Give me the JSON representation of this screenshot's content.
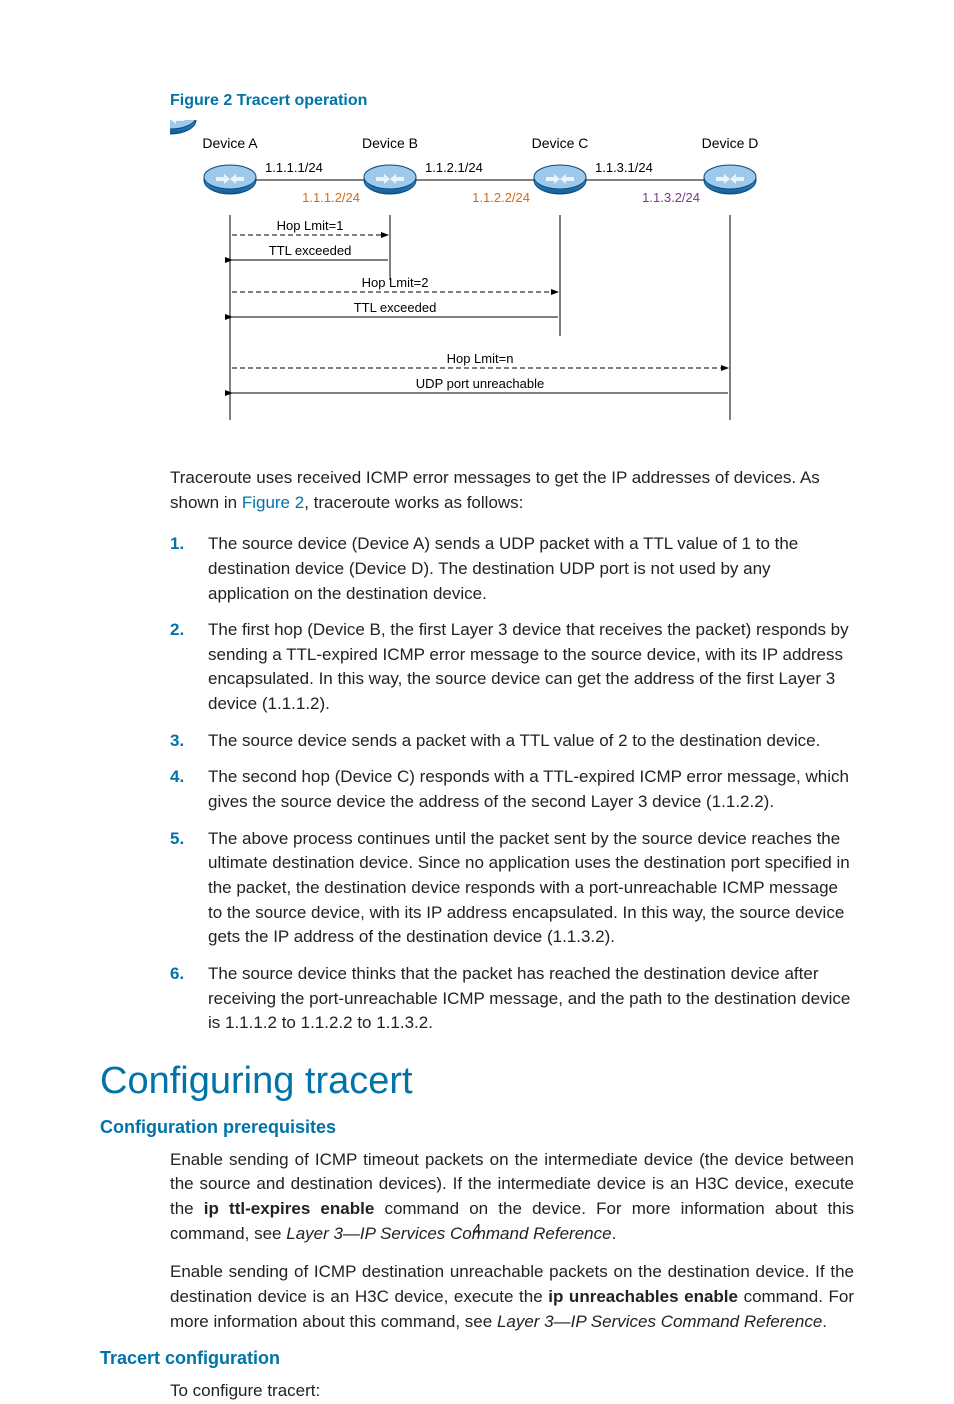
{
  "figure": {
    "caption": "Figure 2 Tracert operation",
    "devices": [
      "Device A",
      "Device B",
      "Device C",
      "Device D"
    ],
    "ip_top": [
      "1.1.1.1/24",
      "1.1.2.1/24",
      "1.1.3.1/24"
    ],
    "ip_bottom": [
      "1.1.1.2/24",
      "1.1.2.2/24",
      "1.1.3.2/24"
    ],
    "hops": {
      "h1_req": "Hop Lmit=1",
      "h1_rep": "TTL exceeded",
      "h2_req": "Hop Lmit=2",
      "h2_rep": "TTL exceeded",
      "hn_req": "Hop Lmit=n",
      "hn_rep": "UDP port unreachable"
    }
  },
  "intro": {
    "pre": "Traceroute uses received ICMP error messages to get the IP addresses of devices. As shown in ",
    "link": "Figure 2",
    "post": ", traceroute works as follows:"
  },
  "steps": [
    "The source device (Device A) sends a UDP packet with a TTL value of 1 to the destination device (Device D). The destination UDP port is not used by any application on the destination device.",
    "The first hop (Device B, the first Layer 3 device that receives the packet) responds by sending a TTL-expired ICMP error message to the source device, with its IP address encapsulated. In this way, the source device can get the address of the first Layer 3 device (1.1.1.2).",
    "The source device sends a packet with a TTL value of 2 to the destination device.",
    "The second hop (Device C) responds with a TTL-expired ICMP error message, which gives the source device the address of the second Layer 3 device (1.1.2.2).",
    "The above process continues until the packet sent by the source device reaches the ultimate destination device. Since no application uses the destination port specified in the packet, the destination device responds with a port-unreachable ICMP message to the source device, with its IP address encapsulated. In this way, the source device gets the IP address of the destination device (1.1.3.2).",
    "The source device thinks that the packet has reached the destination device after receiving the port-unreachable ICMP message, and the path to the destination device is 1.1.1.2 to 1.1.2.2 to 1.1.3.2."
  ],
  "h1": "Configuring tracert",
  "h2a": "Configuration prerequisites",
  "p1": {
    "a": "Enable sending of ICMP timeout packets on the intermediate device (the device between the source and destination devices). If the intermediate device is an H3C device, execute the ",
    "b": "ip ttl-expires enable",
    "c": " command on the device. For more information about this command, see ",
    "i": "Layer 3—IP Services Command Reference",
    "d": "."
  },
  "p2": {
    "a": "Enable sending of ICMP destination unreachable packets on the destination device. If the destination device is an H3C device, execute the ",
    "b": "ip unreachables enable",
    "c": " command. For more information about this command, see ",
    "i": "Layer 3—IP Services Command Reference",
    "d": "."
  },
  "h2b": "Tracert configuration",
  "p3": "To configure tracert:",
  "page_number": "4"
}
